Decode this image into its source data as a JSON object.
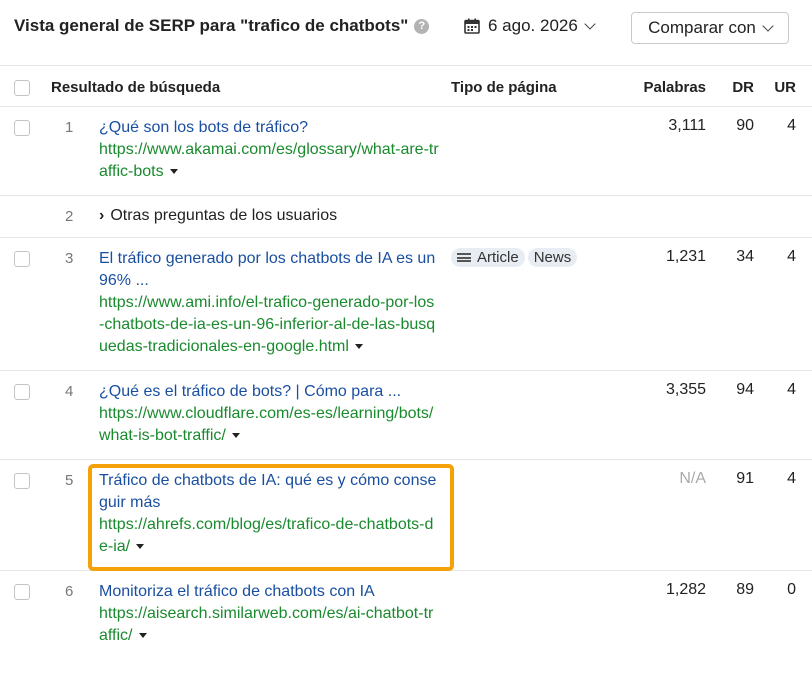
{
  "header": {
    "title": "Vista general de SERP para \"trafico de chatbots\"",
    "help": "?",
    "date": "6 ago. 2026",
    "compare": "Comparar con"
  },
  "table": {
    "columns": [
      "Resultado de búsqueda",
      "Tipo de página",
      "Palabras",
      "DR",
      "UR"
    ],
    "rows": [
      {
        "pos": "1",
        "title": "¿Qué son los bots de tráfico?",
        "url": "https://www.akamai.com/es/glossary/what-are-traffic-bots",
        "tags": [],
        "words": "3,111",
        "dr": "90",
        "ur": "4"
      },
      {
        "pos": "2",
        "other": "Otras preguntas de los usuarios"
      },
      {
        "pos": "3",
        "title": "El tráfico generado por los chatbots de IA es un 96% ...",
        "url": "https://www.ami.info/el-trafico-generado-por-los-chatbots-de-ia-es-un-96-inferior-al-de-las-busquedas-tradicionales-en-google.html",
        "tags": [
          "Article",
          "News"
        ],
        "words": "1,231",
        "dr": "34",
        "ur": "4"
      },
      {
        "pos": "4",
        "title": "¿Qué es el tráfico de bots? | Cómo para ...",
        "url": "https://www.cloudflare.com/es-es/learning/bots/what-is-bot-traffic/",
        "tags": [],
        "words": "3,355",
        "dr": "94",
        "ur": "4"
      },
      {
        "pos": "5",
        "title": "Tráfico de chatbots de IA: qué es y cómo conseguir más",
        "url": "https://ahrefs.com/blog/es/trafico-de-chatbots-de-ia/",
        "tags": [],
        "words": "N/A",
        "dr": "91",
        "ur": "4"
      },
      {
        "pos": "6",
        "title": "Monitoriza el tráfico de chatbots con IA",
        "url": "https://aisearch.similarweb.com/es/ai-chatbot-traffic/",
        "tags": [],
        "words": "1,282",
        "dr": "89",
        "ur": "0"
      }
    ]
  },
  "colors": {
    "highlight": "#f5a20a",
    "link": "#1a4fa0",
    "url": "#1a8a2e"
  }
}
